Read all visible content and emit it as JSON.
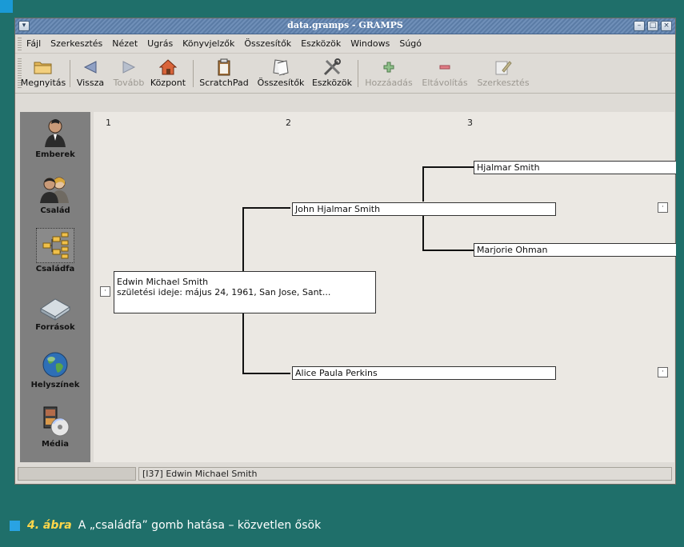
{
  "window": {
    "title": "data.gramps - GRAMPS"
  },
  "menu": [
    "Fájl",
    "Szerkesztés",
    "Nézet",
    "Ugrás",
    "Könyvjelzők",
    "Összesítők",
    "Eszközök",
    "Windows",
    "Súgó"
  ],
  "toolbar": {
    "open": "Megnyitás",
    "back": "Vissza",
    "forward": "Tovább",
    "home": "Központ",
    "scratchpad": "ScratchPad",
    "reports": "Összesítők",
    "tools": "Eszközök",
    "add": "Hozzáadás",
    "remove": "Eltávolítás",
    "edit": "Szerkesztés"
  },
  "sidebar": [
    "Emberek",
    "Család",
    "Családfa",
    "Források",
    "Helyszínek",
    "Média"
  ],
  "tree": {
    "columns": [
      "1",
      "2",
      "3"
    ],
    "person1_name": "Edwin Michael Smith",
    "person1_birth": "születési ideje: május 24, 1961, San Jose, Sant...",
    "father": "John Hjalmar Smith",
    "mother": "Alice Paula Perkins",
    "paternal_grandfather": "Hjalmar Smith",
    "paternal_grandmother": "Marjorie Ohman",
    "expander": "·"
  },
  "status": {
    "text": "[I37] Edwin Michael Smith"
  },
  "caption": {
    "figure": "4. ábra",
    "text": "A „családfa” gomb hatása – közvetlen ősök"
  },
  "colors": {
    "background": "#1f6f6a",
    "canvas": "#ebe8e3",
    "titlebar": "#5b7ca6",
    "caption_accent": "#ffd74a"
  }
}
